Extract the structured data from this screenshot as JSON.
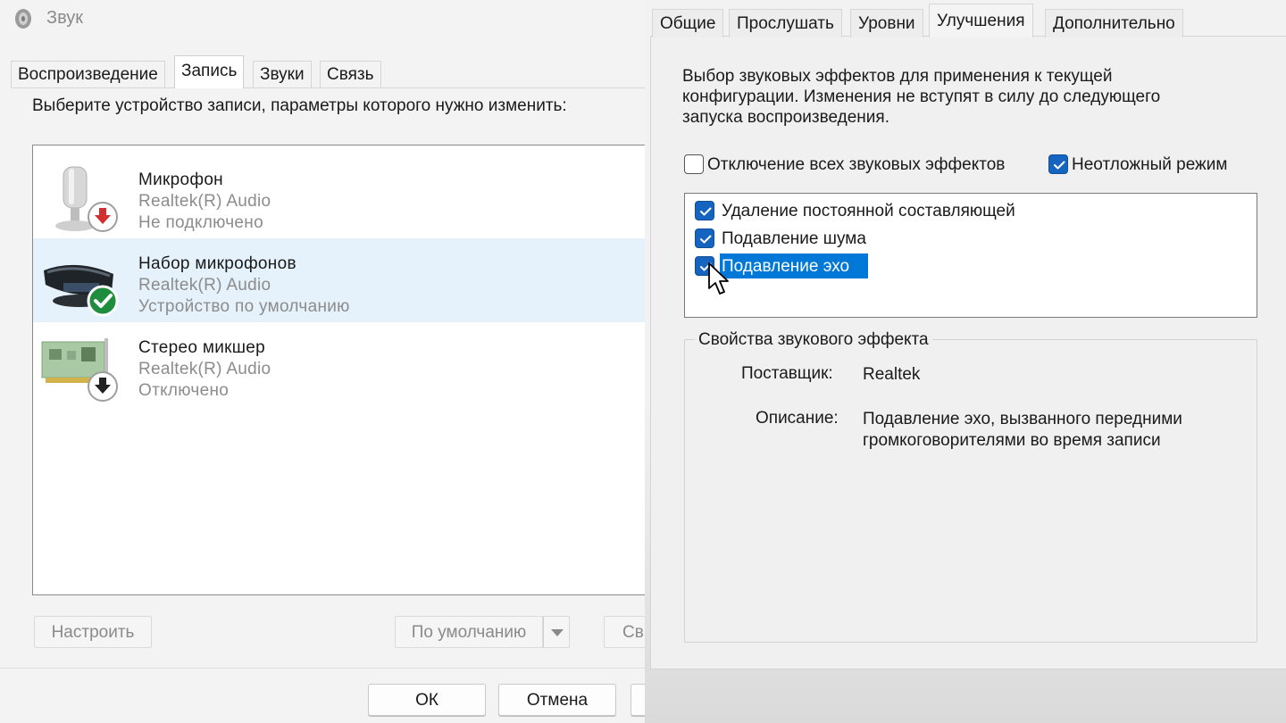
{
  "left_window": {
    "title": "Звук",
    "tabs": [
      {
        "label": "Воспроизведение",
        "active": false
      },
      {
        "label": "Запись",
        "active": true
      },
      {
        "label": "Звуки",
        "active": false
      },
      {
        "label": "Связь",
        "active": false
      }
    ],
    "prompt": "Выберите устройство записи, параметры которого нужно изменить:",
    "devices": [
      {
        "name": "Микрофон",
        "driver": "Realtek(R) Audio",
        "status": "Не подключено",
        "icon": "microphone-icon",
        "badge": "red-down-arrow-badge"
      },
      {
        "name": "Набор микрофонов",
        "driver": "Realtek(R) Audio",
        "status": "Устройство по умолчанию",
        "icon": "microphone-array-icon",
        "badge": "green-check-badge",
        "selected": true
      },
      {
        "name": "Стерео микшер",
        "driver": "Realtek(R) Audio",
        "status": "Отключено",
        "icon": "sound-card-icon",
        "badge": "black-down-arrow-badge"
      }
    ],
    "buttons": {
      "configure": "Настроить",
      "set_default": "По умолчанию",
      "properties_partial": "Св",
      "ok": "ОК",
      "cancel": "Отмена"
    }
  },
  "right_window": {
    "tabs": [
      {
        "label": "Общие",
        "active": false
      },
      {
        "label": "Прослушать",
        "active": false
      },
      {
        "label": "Уровни",
        "active": false
      },
      {
        "label": "Улучшения",
        "active": true
      },
      {
        "label": "Дополнительно",
        "active": false
      }
    ],
    "description_lines": [
      "Выбор звуковых эффектов для применения к текущей",
      "конфигурации. Изменения не вступят в силу до следующего",
      "запуска воспроизведения."
    ],
    "disable_all": {
      "label": "Отключение всех звуковых эффектов",
      "checked": false
    },
    "immediate_mode": {
      "label": "Неотложный режим",
      "checked": true
    },
    "effects": [
      {
        "label": "Удаление постоянной составляющей",
        "checked": true
      },
      {
        "label": "Подавление шума",
        "checked": true
      },
      {
        "label": "Подавление эхо",
        "checked": true,
        "selected": true
      }
    ],
    "properties": {
      "group_title": "Свойства звукового эффекта",
      "provider_key": "Поставщик:",
      "provider_value": "Realtek",
      "description_key": "Описание:",
      "description_lines": [
        "Подавление эхо, вызванного передними",
        "громкоговорителями во время записи"
      ]
    }
  },
  "colors": {
    "accent": "#0078d7",
    "checkbox_blue": "#1565c0",
    "selection_bg": "#e5f1fb",
    "ok_green": "#1e8e3e",
    "error_red": "#d32f2f"
  }
}
